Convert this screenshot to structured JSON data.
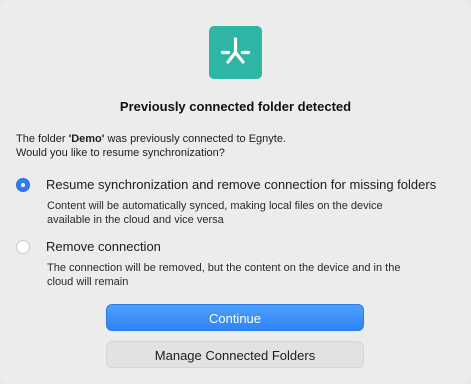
{
  "dialog": {
    "title": "Previously connected folder detected",
    "intro_prefix": "The folder ",
    "folder_name": "'Demo'",
    "intro_suffix": " was previously connected to Egnyte.",
    "intro_line2": "Would you like to resume synchronization?",
    "options": [
      {
        "label": "Resume synchronization and remove connection for missing folders",
        "description": "Content will be automatically synced, making local files on the device available in the cloud and vice versa",
        "selected": true
      },
      {
        "label": "Remove connection",
        "description": "The connection will be removed, but the content on the device and in the cloud will remain",
        "selected": false
      }
    ],
    "primary_button": "Continue",
    "secondary_button": "Manage Connected Folders"
  },
  "colors": {
    "logo_bg": "#2fb5a4",
    "accent": "#2f7cf6"
  },
  "icons": {
    "app_logo": "egnyte-logo-icon"
  }
}
